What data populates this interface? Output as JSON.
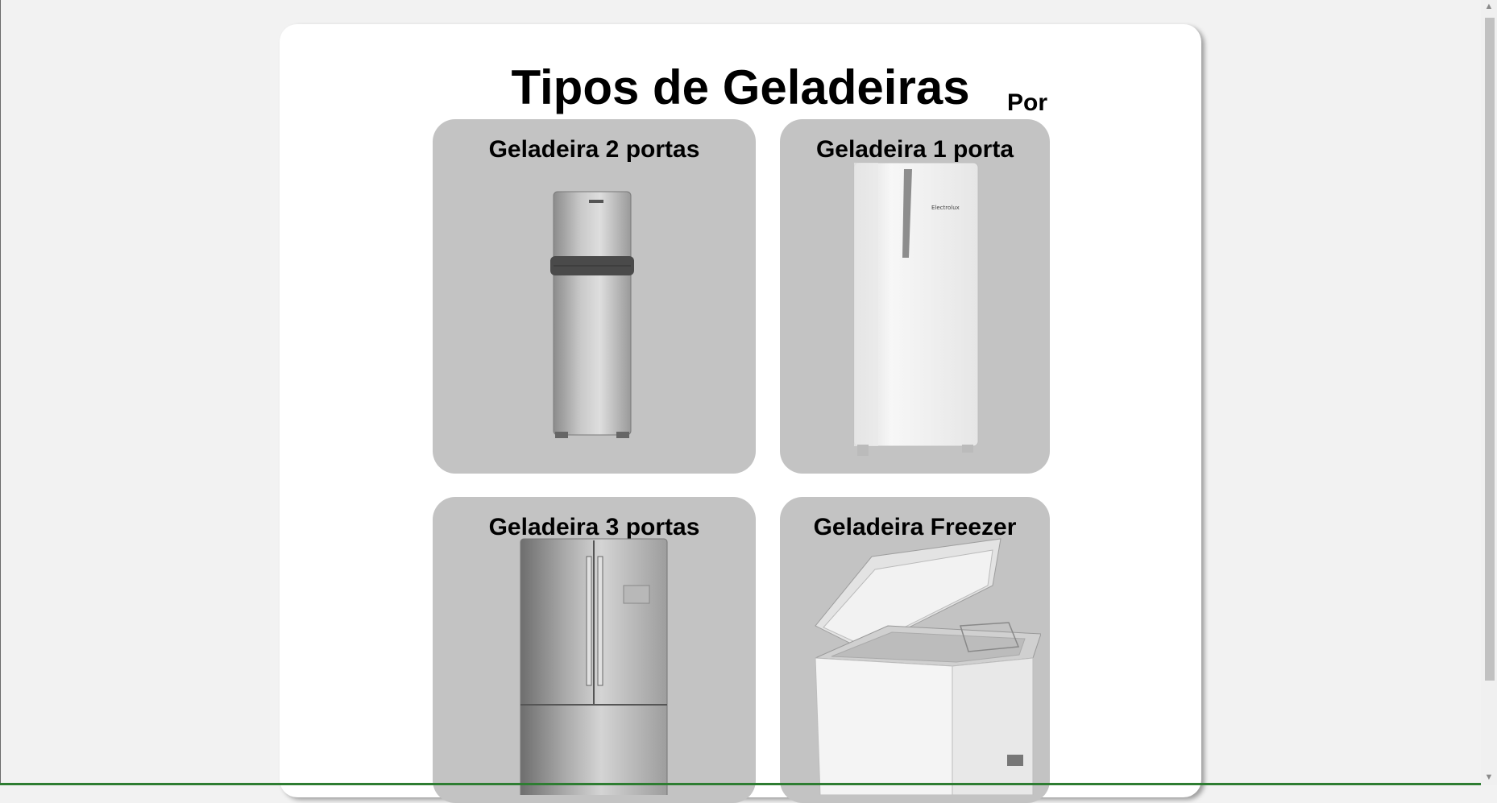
{
  "page": {
    "title": "Tipos de Geladeiras",
    "byline": "Por"
  },
  "cards": [
    {
      "title": "Geladeira 2 portas",
      "image": "two-door-fridge-photo"
    },
    {
      "title": "Geladeira 1 porta",
      "image": "one-door-fridge-photo"
    },
    {
      "title": "Geladeira 3 portas",
      "image": "french-door-fridge-photo"
    },
    {
      "title": "Geladeira Freezer",
      "image": "chest-freezer-photo"
    }
  ],
  "scrollbar": {
    "up": "▲",
    "down": "▼"
  },
  "colors": {
    "card_bg": "#c3c3c3",
    "page_bg": "#ffffff",
    "body_bg": "#f2f2f2"
  }
}
